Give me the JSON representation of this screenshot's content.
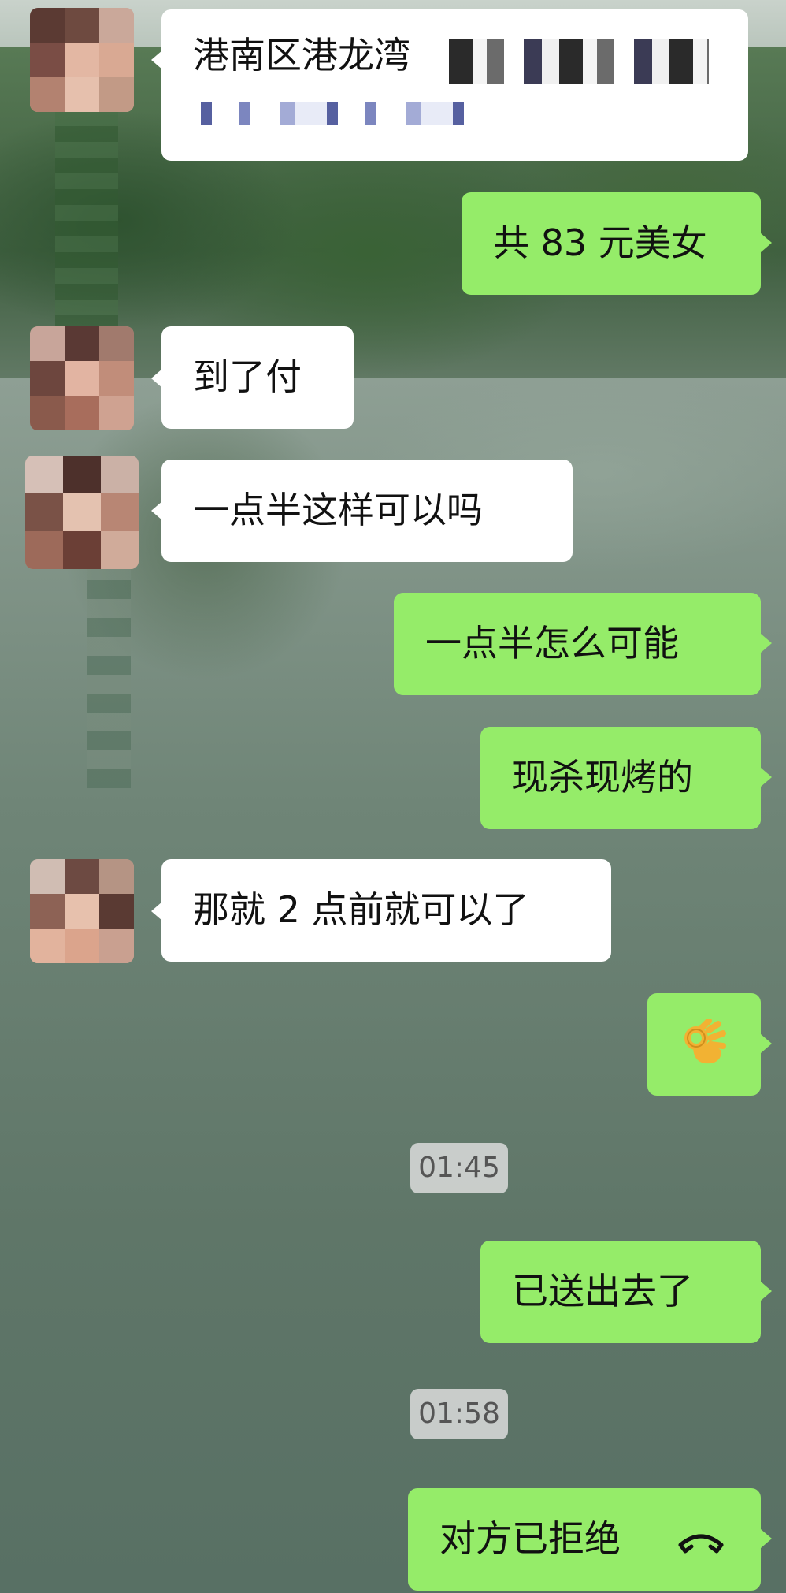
{
  "chat": {
    "messages": [
      {
        "side": "left",
        "text": "港南区港龙湾"
      },
      {
        "side": "right",
        "text": "共 83 元美女"
      },
      {
        "side": "left",
        "text": "到了付"
      },
      {
        "side": "left",
        "text": "一点半这样可以吗"
      },
      {
        "side": "right",
        "text": "一点半怎么可能"
      },
      {
        "side": "right",
        "text": "现杀现烤的"
      },
      {
        "side": "left",
        "text": "那就 2 点前就可以了"
      },
      {
        "side": "right",
        "emoji": "ok-hand"
      },
      {
        "side": "right",
        "text": "已送出去了"
      },
      {
        "side": "right",
        "text": "对方已拒绝",
        "icon": "hangup-icon"
      }
    ],
    "timestamps": [
      "01:45",
      "01:58"
    ]
  },
  "colors": {
    "incoming_bubble": "#ffffff",
    "outgoing_bubble": "#95ec69",
    "timestamp_bg": "#dcdcdc"
  }
}
